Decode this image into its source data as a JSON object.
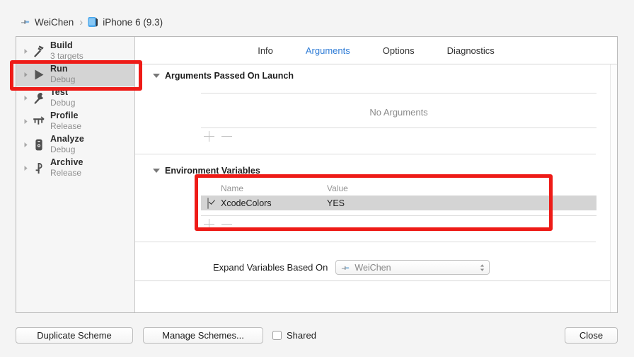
{
  "breadcrumb": {
    "scheme_icon": "scheme-hammer-icon",
    "scheme": "WeiChen",
    "separator": "›",
    "device_icon": "ios-simulator-icon",
    "device": "iPhone 6 (9.3)"
  },
  "sidebar": {
    "items": [
      {
        "title": "Build",
        "subtitle": "3 targets",
        "icon": "hammer-icon",
        "selected": false
      },
      {
        "title": "Run",
        "subtitle": "Debug",
        "icon": "play-icon",
        "selected": true
      },
      {
        "title": "Test",
        "subtitle": "Debug",
        "icon": "wrench-icon",
        "selected": false
      },
      {
        "title": "Profile",
        "subtitle": "Release",
        "icon": "speedometer-icon",
        "selected": false
      },
      {
        "title": "Analyze",
        "subtitle": "Debug",
        "icon": "analyze-icon",
        "selected": false
      },
      {
        "title": "Archive",
        "subtitle": "Release",
        "icon": "archive-icon",
        "selected": false
      }
    ]
  },
  "tabs": [
    {
      "label": "Info",
      "active": false
    },
    {
      "label": "Arguments",
      "active": true
    },
    {
      "label": "Options",
      "active": false
    },
    {
      "label": "Diagnostics",
      "active": false
    }
  ],
  "arguments_section": {
    "title": "Arguments Passed On Launch",
    "empty_text": "No Arguments",
    "add_label": "+",
    "remove_label": "−"
  },
  "environment_section": {
    "title": "Environment Variables",
    "columns": {
      "name": "Name",
      "value": "Value"
    },
    "rows": [
      {
        "checked": true,
        "name": "XcodeColors",
        "value": "YES"
      }
    ],
    "add_label": "+",
    "remove_label": "−"
  },
  "expand_variables": {
    "label": "Expand Variables Based On",
    "selected": "WeiChen",
    "icon": "scheme-hammer-icon"
  },
  "footer": {
    "duplicate_scheme": "Duplicate Scheme",
    "manage_schemes": "Manage Schemes...",
    "shared_label": "Shared",
    "shared_checked": false,
    "close": "Close"
  },
  "colors": {
    "accent_blue": "#2f7cd6",
    "annotation_red": "#ee1b17",
    "selection_gray": "#d4d4d4"
  }
}
